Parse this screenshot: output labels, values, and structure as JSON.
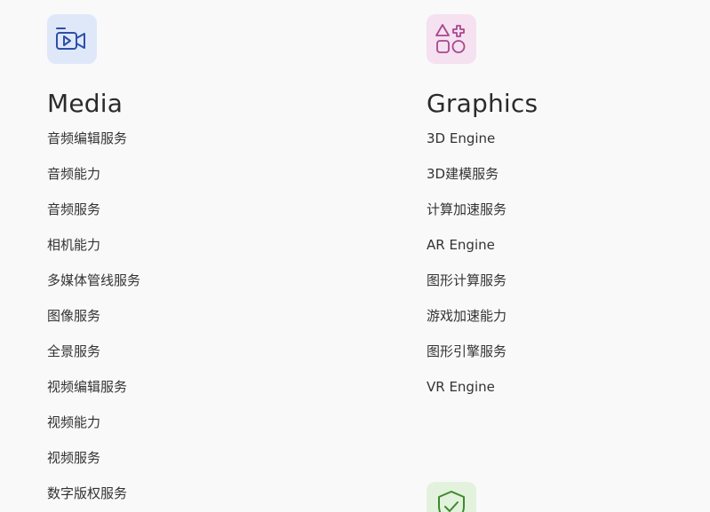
{
  "sections": {
    "media": {
      "icon": "video-camera-icon",
      "title": "Media",
      "items": [
        "音频编辑服务",
        "音频能力",
        "音频服务",
        "相机能力",
        "多媒体管线服务",
        "图像服务",
        "全景服务",
        "视频编辑服务",
        "视频能力",
        "视频服务",
        "数字版权服务"
      ]
    },
    "graphics": {
      "icon": "shapes-icon",
      "title": "Graphics",
      "items": [
        "3D Engine",
        "3D建模服务",
        "计算加速服务",
        "AR Engine",
        "图形计算服务",
        "游戏加速能力",
        "图形引擎服务",
        "VR Engine"
      ]
    },
    "security": {
      "icon": "shield-check-icon"
    }
  },
  "colors": {
    "media_icon": "#2d4fa8",
    "media_tile": "#dfe8f8",
    "graphics_icon": "#a8468f",
    "graphics_tile": "#f5e1f0",
    "security_icon": "#3d8a2e",
    "security_tile": "#e3f2dc"
  }
}
